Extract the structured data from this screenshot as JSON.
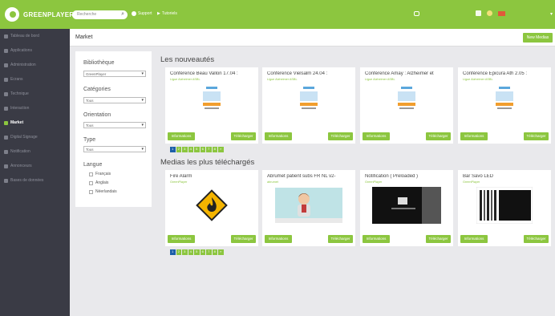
{
  "app": {
    "brand": "GREENPLAYER"
  },
  "topbar": {
    "search_placeholder": "Recherche",
    "support": "Support",
    "tutorials": "Tutoriels"
  },
  "sidebar": {
    "items": [
      {
        "label": "Tableau de bord",
        "icon": "dashboard-icon"
      },
      {
        "label": "Applications",
        "icon": "apps-icon"
      },
      {
        "label": "Administration",
        "icon": "wrench-icon"
      },
      {
        "label": "Ecrans",
        "icon": "screen-icon"
      },
      {
        "label": "Technique",
        "icon": "tools-icon"
      },
      {
        "label": "Interaction",
        "icon": "interaction-icon"
      },
      {
        "label": "Market",
        "icon": "cart-icon",
        "active": true
      },
      {
        "label": "Digital Signage",
        "icon": "monitor-icon"
      },
      {
        "label": "Notification",
        "icon": "bell-icon"
      },
      {
        "label": "Annonceurs",
        "icon": "megaphone-icon"
      },
      {
        "label": "Bases de données",
        "icon": "database-icon"
      }
    ]
  },
  "page": {
    "title": "Market",
    "new_media": "New Medias"
  },
  "filters": {
    "bibliotheque_label": "Bibliothèque",
    "bibliotheque_value": "GreenPlayer",
    "categories_label": "Catégories",
    "categories_value": "Tous",
    "orientation_label": "Orientation",
    "orientation_value": "Tous",
    "type_label": "Type",
    "type_value": "Tous",
    "langue_label": "Langue",
    "languages": [
      "Français",
      "Anglais",
      "Néerlandais"
    ]
  },
  "sections": {
    "new": "Les nouveautés",
    "popular": "Medias les plus téléchargés"
  },
  "buttons": {
    "info": "Informations",
    "download": "Télécharger"
  },
  "new_cards": [
    {
      "title": "Conférence Beau Vallon 17.04 :",
      "sub": "Ligue Alzheimer ASBL"
    },
    {
      "title": "Conférence Vielsalm 24.04 :",
      "sub": "Ligue Alzheimer ASBL"
    },
    {
      "title": "Conférence Amay : Alzheimer et",
      "sub": "Ligue Alzheimer ASBL"
    },
    {
      "title": "Conférence Epicura Ath 2.05 :",
      "sub": "Ligue Alzheimer ASBL"
    }
  ],
  "popular_cards": [
    {
      "title": "Fire Alarm",
      "sub": "GreenPlayer"
    },
    {
      "title": "Abrumet patient subs FR NL v2-",
      "sub": "abrumet"
    },
    {
      "title": "Notification ( Preloaded )",
      "sub": "GreenPlayer"
    },
    {
      "title": "Bar Savo LED",
      "sub": "GreenPlayer"
    }
  ],
  "pager": [
    "1",
    "2",
    "3",
    "4",
    "5",
    "6",
    "7",
    "8",
    "»"
  ],
  "colors": {
    "accent": "#8cc63f",
    "sidebar": "#3a3b45",
    "page_current": "#1d5fa8"
  }
}
